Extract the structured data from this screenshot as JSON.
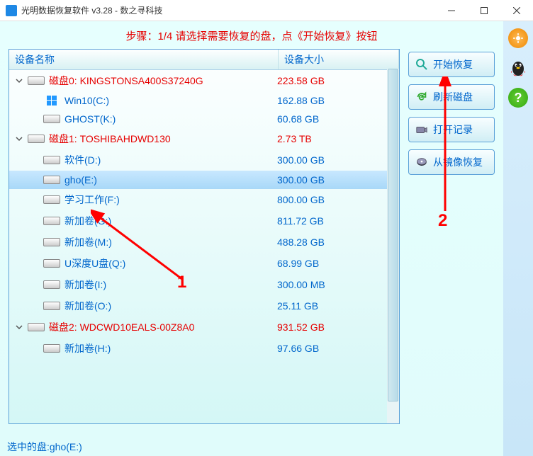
{
  "window": {
    "title": "光明数据恢复软件 v3.28 - 数之寻科技"
  },
  "step_text": "步骤：1/4 请选择需要恢复的盘，点《开始恢复》按钮",
  "headers": {
    "name": "设备名称",
    "size": "设备大小"
  },
  "rows": [
    {
      "type": "disk",
      "expanded": true,
      "name": "磁盘0: KINGSTONSA400S37240G",
      "size": "223.58 GB"
    },
    {
      "type": "vol",
      "icon": "win",
      "name": "Win10(C:)",
      "size": "162.88 GB"
    },
    {
      "type": "vol",
      "name": "GHOST(K:)",
      "size": "60.68 GB"
    },
    {
      "type": "disk",
      "expanded": true,
      "name": "磁盘1: TOSHIBAHDWD130",
      "size": "2.73 TB"
    },
    {
      "type": "vol",
      "name": "软件(D:)",
      "size": "300.00 GB"
    },
    {
      "type": "vol",
      "name": "gho(E:)",
      "size": "300.00 GB",
      "selected": true
    },
    {
      "type": "vol",
      "name": "学习工作(F:)",
      "size": "800.00 GB"
    },
    {
      "type": "vol",
      "name": "新加卷(G:)",
      "size": "811.72 GB"
    },
    {
      "type": "vol",
      "name": "新加卷(M:)",
      "size": "488.28 GB"
    },
    {
      "type": "vol",
      "name": "U深度U盘(Q:)",
      "size": "68.99 GB"
    },
    {
      "type": "vol",
      "name": "新加卷(I:)",
      "size": "300.00 MB"
    },
    {
      "type": "vol",
      "name": "新加卷(O:)",
      "size": "25.11 GB"
    },
    {
      "type": "disk",
      "expanded": true,
      "name": "磁盘2: WDCWD10EALS-00Z8A0",
      "size": "931.52 GB"
    },
    {
      "type": "vol",
      "name": "新加卷(H:)",
      "size": "97.66 GB"
    }
  ],
  "buttons": {
    "start": "开始恢复",
    "refresh": "刷新磁盘",
    "open_log": "打开记录",
    "from_image": "从镜像恢复"
  },
  "status": "选中的盘:gho(E:)",
  "annotations": {
    "one": "1",
    "two": "2"
  }
}
